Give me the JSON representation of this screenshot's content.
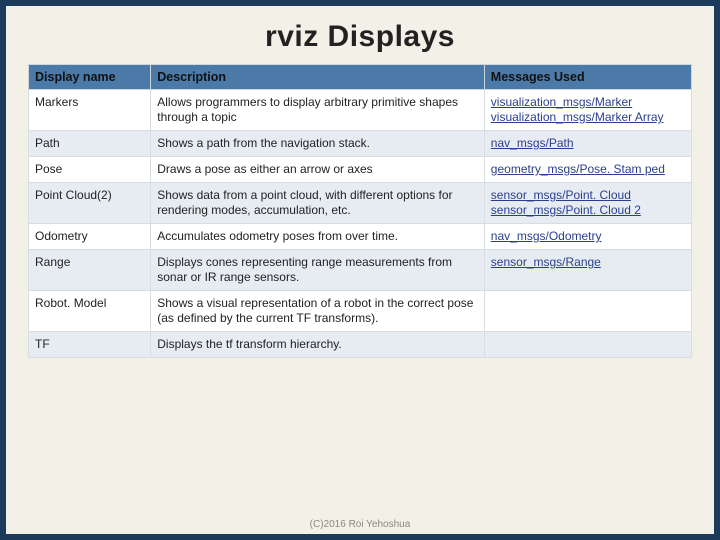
{
  "title": "rviz Displays",
  "columns": [
    "Display name",
    "Description",
    "Messages Used"
  ],
  "rows": [
    {
      "name": "Markers",
      "desc": "Allows programmers to display arbitrary primitive shapes through a topic",
      "msgs": [
        "visualization_msgs/Marker",
        "visualization_msgs/Marker Array"
      ]
    },
    {
      "name": "Path",
      "desc": "Shows a path from the navigation stack.",
      "msgs": [
        "nav_msgs/Path"
      ]
    },
    {
      "name": "Pose",
      "desc": "Draws a pose as either an arrow or axes",
      "msgs": [
        "geometry_msgs/Pose. Stam ped"
      ]
    },
    {
      "name": "Point Cloud(2)",
      "desc": "Shows data from a point cloud, with different options for rendering modes, accumulation, etc.",
      "msgs": [
        "sensor_msgs/Point. Cloud",
        "sensor_msgs/Point. Cloud 2"
      ]
    },
    {
      "name": "Odometry",
      "desc": "Accumulates odometry poses from over time.",
      "msgs": [
        "nav_msgs/Odometry"
      ]
    },
    {
      "name": "Range",
      "desc": "Displays cones representing range measurements from sonar or IR range sensors.",
      "msgs": [
        "sensor_msgs/Range"
      ]
    },
    {
      "name": "Robot. Model",
      "desc": "Shows a visual representation of a robot in the correct pose (as defined by the current TF transforms).",
      "msgs": []
    },
    {
      "name": "TF",
      "desc": "Displays the tf transform hierarchy.",
      "msgs": []
    }
  ],
  "footer": "(C)2016 Roi Yehoshua"
}
